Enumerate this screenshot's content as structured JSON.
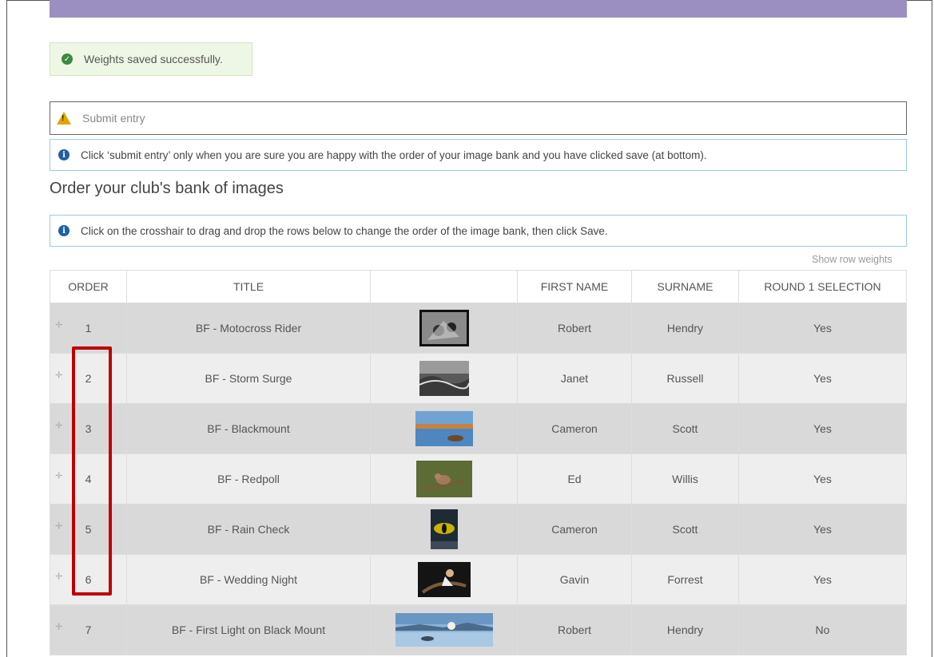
{
  "alerts": {
    "success": "Weights saved successfully.",
    "submit": "Submit entry",
    "submit_info": "Click ‘submit entry’ only when you are sure you are happy with the order of your image bank and you have clicked save (at bottom).",
    "drag_info": "Click on the crosshair to drag and drop the rows below to change the order of the image bank, then click Save."
  },
  "heading": "Order your club's bank of images",
  "show_row_weights": "Show row weights",
  "table": {
    "headers": [
      "ORDER",
      "TITLE",
      "",
      "FIRST NAME",
      "SURNAME",
      "ROUND 1 SELECTION"
    ],
    "rows": [
      {
        "order": "1",
        "title": "BF - Motocross Rider",
        "first": "Robert",
        "surname": "Hendry",
        "round1": "Yes"
      },
      {
        "order": "2",
        "title": "BF - Storm Surge",
        "first": "Janet",
        "surname": "Russell",
        "round1": "Yes"
      },
      {
        "order": "3",
        "title": "BF - Blackmount",
        "first": "Cameron",
        "surname": "Scott",
        "round1": "Yes"
      },
      {
        "order": "4",
        "title": "BF - Redpoll",
        "first": "Ed",
        "surname": "Willis",
        "round1": "Yes"
      },
      {
        "order": "5",
        "title": "BF - Rain Check",
        "first": "Cameron",
        "surname": "Scott",
        "round1": "Yes"
      },
      {
        "order": "6",
        "title": "BF - Wedding Night",
        "first": "Gavin",
        "surname": "Forrest",
        "round1": "Yes"
      },
      {
        "order": "7",
        "title": "BF - First Light on Black Mount",
        "first": "Robert",
        "surname": "Hendry",
        "round1": "No"
      }
    ]
  },
  "colors": {
    "accent_bar": "#9a8fc0",
    "success_icon": "#3a8a3f",
    "warning_icon": "#e2a500",
    "info_icon": "#1f5fa8",
    "highlight": "#c00000"
  }
}
